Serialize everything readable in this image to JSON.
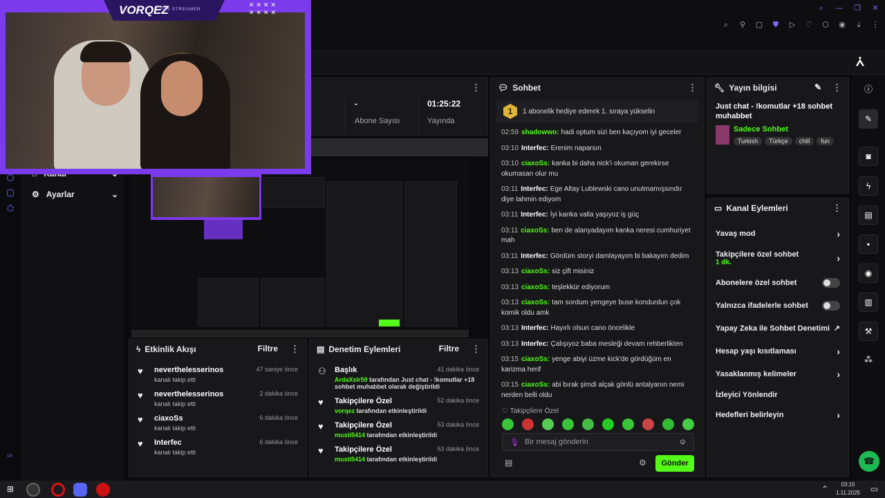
{
  "webcam": {
    "title": "VORQEZ",
    "subtitle": "P4S STREAMER",
    "corner_marks": "✕✕✕✕\n✕✕✕✕"
  },
  "sidebar": {
    "items": [
      {
        "label": "Kanal",
        "icon": "home-icon"
      },
      {
        "label": "Ayarlar",
        "icon": "gear-icon"
      }
    ]
  },
  "stats": [
    {
      "value": "-",
      "label": "Abone Sayısı"
    },
    {
      "value": "01:25:22",
      "label": "Yayında"
    }
  ],
  "chat": {
    "title": "Sohbet",
    "banner_count": "1",
    "banner_text": "1 abonelik hediye ederek 1. sıraya yükselin",
    "messages": [
      {
        "time": "02:59",
        "user": "shadowwo:",
        "color": "green",
        "text": "hadi optum sizi ben kaçıyom iyi geceler"
      },
      {
        "time": "03:10",
        "user": "Interfec:",
        "color": "white",
        "text": "Erenim naparsın"
      },
      {
        "time": "03:10",
        "user": "ciaxoSs:",
        "color": "green",
        "text": "kanka bi daha nick'i okuman gerekirse okumasan olur mu"
      },
      {
        "time": "03:11",
        "user": "Interfec:",
        "color": "white",
        "text": "Ege Altay Lublewski cano unutmamışsındır diye tahmin ediyom"
      },
      {
        "time": "03:11",
        "user": "Interfec:",
        "color": "white",
        "text": "İyi kanka valla yaşıyoz iş güç"
      },
      {
        "time": "03:11",
        "user": "ciaxoSs:",
        "color": "green",
        "text": "ben de alanyadayım kanka neresi cumhuriyet mah"
      },
      {
        "time": "03:11",
        "user": "Interfec:",
        "color": "white",
        "text": "Gördüm storyi damlayayım bi bakayım dedim"
      },
      {
        "time": "03:13",
        "user": "ciaxoSs:",
        "color": "green",
        "text": "siz çift misiniz"
      },
      {
        "time": "03:13",
        "user": "ciaxoSs:",
        "color": "green",
        "text": "teşlekkür ediyorum"
      },
      {
        "time": "03:13",
        "user": "ciaxoSs:",
        "color": "green",
        "text": "tam sordum yengeye buse kondurdun çok komik oldu amk"
      },
      {
        "time": "03:13",
        "user": "Interfec:",
        "color": "white",
        "text": "Hayırlı olsun cano öncelikle"
      },
      {
        "time": "03:13",
        "user": "Interfec:",
        "color": "white",
        "text": "Çalışıyoz baba mesleği devam rehberlikten"
      },
      {
        "time": "03:15",
        "user": "ciaxoSs:",
        "color": "green",
        "text": "yenge abiyi üzme kick'de gördüğüm en karizma herif"
      },
      {
        "time": "03:15",
        "user": "ciaxoSs:",
        "color": "green",
        "text": "abi bırak şimdi alçak gönlü antalyanın nemi nerden belli oldu"
      }
    ],
    "follower_label": "Takipçilere Özel",
    "input_placeholder": "Bir mesaj gönderin",
    "send_label": "Gönder"
  },
  "stream_info": {
    "title": "Yayın bilgisi",
    "stream_title": "Just chat - !komutlar +18 sohbet muhabbet",
    "category": "Sadece Sohbet",
    "tags": [
      "Turkish",
      "Türkçe",
      "chill",
      "fun"
    ]
  },
  "channel_actions": {
    "title": "Kanal Eylemleri",
    "items": [
      {
        "label": "Yavaş mod",
        "control": "chevron"
      },
      {
        "label": "Takipçilere özel sohbet",
        "sub": "1 dk.",
        "control": "chevron"
      },
      {
        "label": "Abonelere özel sohbet",
        "control": "toggle"
      },
      {
        "label": "Yalnızca ifadelerle sohbet",
        "control": "toggle"
      },
      {
        "label": "Yapay Zeka ile Sohbet Denetimi",
        "control": "external"
      },
      {
        "label": "Hesap yaşı kısıtlaması",
        "control": "chevron"
      },
      {
        "label": "Yasaklanmış kelimeler",
        "control": "chevron"
      },
      {
        "label": "İzleyici Yönlendir",
        "control": "none"
      },
      {
        "label": "Hedefleri belirleyin",
        "control": "chevron"
      }
    ]
  },
  "activity_feed": {
    "title": "Etkinlik Akışı",
    "filter": "Filtre",
    "items": [
      {
        "name": "neverthelesserinos",
        "time": "47 saniye önce",
        "sub": "kanalı takip etti"
      },
      {
        "name": "neverthelesserinos",
        "time": "2 dakika önce",
        "sub": "kanalı takip etti"
      },
      {
        "name": "ciaxoSs",
        "time": "6 dakika önce",
        "sub": "kanalı takip etti"
      },
      {
        "name": "Interfec",
        "time": "6 dakika önce",
        "sub": "kanalı takip etti"
      }
    ]
  },
  "mod_actions": {
    "title": "Denetim Eylemleri",
    "filter": "Filtre",
    "items": [
      {
        "name": "Başlık",
        "time": "41 dakika önce",
        "user": "ArdaXslr59",
        "sub": "tarafından Just chat - !komutlar +18 sohbet muhabbet olarak değiştirildi"
      },
      {
        "name": "Takipçilere Özel",
        "time": "52 dakika önce",
        "user": "vorqez",
        "sub": "tarafından etkinleştirildi"
      },
      {
        "name": "Takipçilere Özel",
        "time": "53 dakika önce",
        "user": "musti5414",
        "sub": "tarafından etkinleştirildi"
      },
      {
        "name": "Takipçilere Özel",
        "time": "53 dakika önce",
        "user": "musti5414",
        "sub": "tarafından etkinleştirildi"
      }
    ]
  },
  "taskbar": {
    "time": "03:15",
    "date": "1.11.2025"
  },
  "colors": {
    "accent": "#53fc18",
    "brand_purple": "#7c3aed"
  }
}
